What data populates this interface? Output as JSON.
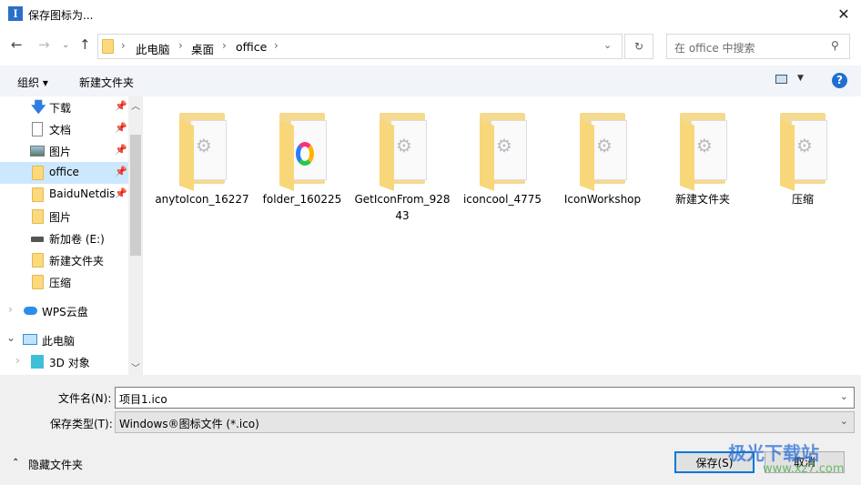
{
  "window": {
    "title": "保存图标为..."
  },
  "address": {
    "crumbs": [
      "此电脑",
      "桌面",
      "office"
    ]
  },
  "search": {
    "placeholder": "在 office 中搜索"
  },
  "toolbar": {
    "organize": "组织 ▾",
    "new_folder": "新建文件夹",
    "help": "?"
  },
  "nav": {
    "items": [
      {
        "label": "下载",
        "pinned": true,
        "icon": "download-icon"
      },
      {
        "label": "文档",
        "pinned": true,
        "icon": "document-icon"
      },
      {
        "label": "图片",
        "pinned": true,
        "icon": "pictures-icon"
      },
      {
        "label": "office",
        "pinned": true,
        "icon": "folder-icon",
        "selected": true
      },
      {
        "label": "BaiduNetdisk",
        "pinned": true,
        "icon": "folder-icon"
      },
      {
        "label": "图片",
        "icon": "folder-icon"
      },
      {
        "label": "新加卷 (E:)",
        "icon": "drive-icon"
      },
      {
        "label": "新建文件夹",
        "icon": "folder-icon"
      },
      {
        "label": "压缩",
        "icon": "folder-icon"
      }
    ],
    "wps": "WPS云盘",
    "pc": "此电脑",
    "obj3d": "3D 对象"
  },
  "files": [
    {
      "name": "anytoIcon_16227",
      "type": "gear"
    },
    {
      "name": "folder_160225",
      "type": "ring"
    },
    {
      "name": "GetIconFrom_92843",
      "type": "gear"
    },
    {
      "name": "iconcool_4775",
      "type": "gear"
    },
    {
      "name": "IconWorkshop",
      "type": "gear"
    },
    {
      "name": "新建文件夹",
      "type": "gear"
    },
    {
      "name": "压缩",
      "type": "gear"
    }
  ],
  "form": {
    "filename_label": "文件名(N):",
    "filename": "项目1.ico",
    "type_label": "保存类型(T):",
    "type": "Windows®图标文件 (*.ico)"
  },
  "footer": {
    "hide_folders": "隐藏文件夹",
    "save": "保存(S)",
    "cancel": "取消"
  },
  "watermark": {
    "text": "极光下载站",
    "url": "www.xz7.com"
  }
}
